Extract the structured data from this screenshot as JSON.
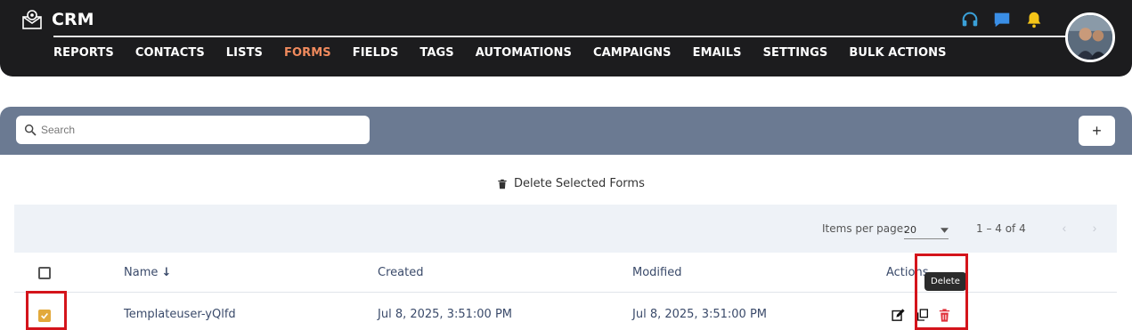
{
  "app": {
    "title": "CRM"
  },
  "nav": {
    "items": [
      {
        "label": "REPORTS",
        "active": false
      },
      {
        "label": "CONTACTS",
        "active": false
      },
      {
        "label": "LISTS",
        "active": false
      },
      {
        "label": "FORMS",
        "active": true
      },
      {
        "label": "FIELDS",
        "active": false
      },
      {
        "label": "TAGS",
        "active": false
      },
      {
        "label": "AUTOMATIONS",
        "active": false
      },
      {
        "label": "CAMPAIGNS",
        "active": false
      },
      {
        "label": "EMAILS",
        "active": false
      },
      {
        "label": "SETTINGS",
        "active": false
      },
      {
        "label": "BULK ACTIONS",
        "active": false
      }
    ]
  },
  "header_icons": [
    "headset-icon",
    "chat-icon",
    "bell-icon"
  ],
  "colors": {
    "accent": "#f08a5d",
    "band": "#6b7a92",
    "checkbox": "#e2a93b",
    "delete": "#e0313b",
    "highlight": "#d4141b"
  },
  "search": {
    "placeholder": "Search"
  },
  "add_button": {
    "label": "+"
  },
  "delete_selected": {
    "label": "Delete Selected Forms"
  },
  "paginator": {
    "items_per_page_label": "Items per page:",
    "items_per_page_value": "20",
    "range_label": "1 – 4 of 4"
  },
  "table": {
    "columns": [
      "Name",
      "Created",
      "Modified",
      "Actions"
    ],
    "sort_indicator": "↓",
    "rows": [
      {
        "name": "Templateuser-yQlfd",
        "created": "Jul 8, 2025, 3:51:00 PM",
        "modified": "Jul 8, 2025, 3:51:00 PM",
        "checked": true
      }
    ]
  },
  "tooltip": {
    "text": "Delete"
  }
}
